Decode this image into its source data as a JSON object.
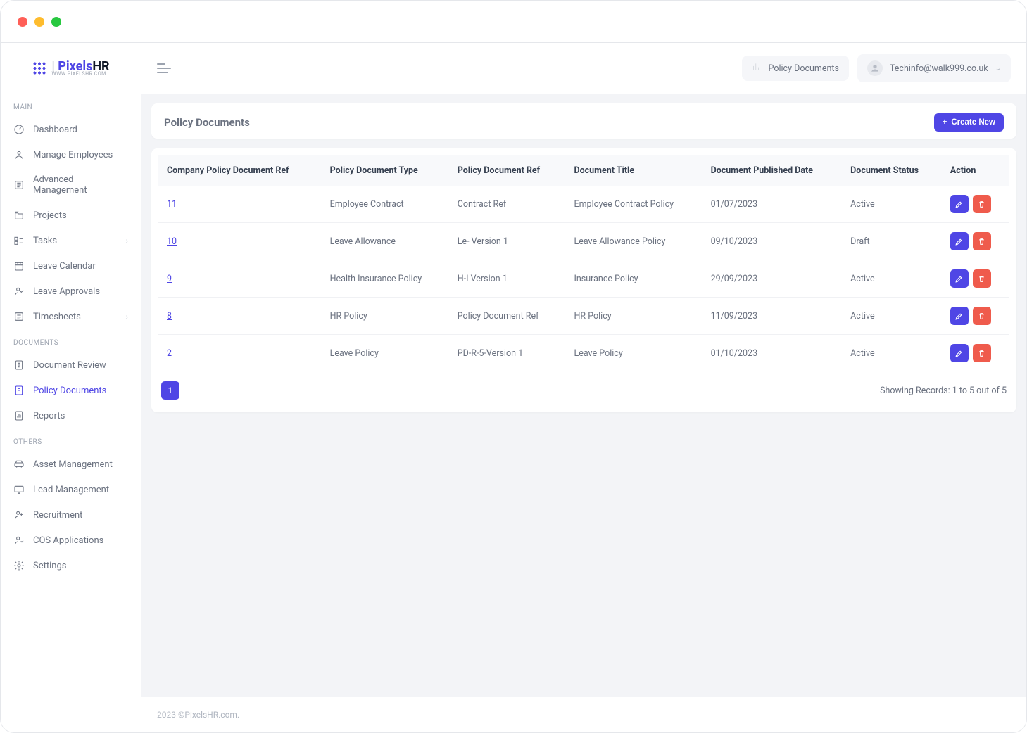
{
  "logo": {
    "brand_a": "Pixels",
    "brand_b": "HR",
    "sub": "WWW.PIXELSHR.COM"
  },
  "sidebar": {
    "sections": [
      {
        "title": "MAIN",
        "items": [
          {
            "label": "Dashboard"
          },
          {
            "label": "Manage Employees"
          },
          {
            "label": "Advanced Management"
          },
          {
            "label": "Projects"
          },
          {
            "label": "Tasks",
            "chevron": true
          },
          {
            "label": "Leave Calendar"
          },
          {
            "label": "Leave Approvals"
          },
          {
            "label": "Timesheets",
            "chevron": true
          }
        ]
      },
      {
        "title": "DOCUMENTS",
        "items": [
          {
            "label": "Document Review"
          },
          {
            "label": "Policy Documents",
            "active": true
          },
          {
            "label": "Reports"
          }
        ]
      },
      {
        "title": "OTHERS",
        "items": [
          {
            "label": "Asset Management"
          },
          {
            "label": "Lead Management"
          },
          {
            "label": "Recruitment"
          },
          {
            "label": "COS Applications"
          },
          {
            "label": "Settings"
          }
        ]
      }
    ]
  },
  "topbar": {
    "breadcrumb": "Policy Documents",
    "user_email": "Techinfo@walk999.co.uk"
  },
  "page": {
    "title": "Policy Documents",
    "create_label": "Create New"
  },
  "table": {
    "headers": {
      "ref": "Company Policy Document Ref",
      "type": "Policy Document Type",
      "doc_ref": "Policy Document Ref",
      "title": "Document Title",
      "published": "Document Published Date",
      "status": "Document Status",
      "action": "Action"
    },
    "rows": [
      {
        "ref": "11",
        "type": "Employee Contract",
        "doc_ref": "Contract Ref",
        "title": "Employee Contract Policy",
        "published": "01/07/2023",
        "status": "Active"
      },
      {
        "ref": "10",
        "type": "Leave Allowance",
        "doc_ref": "Le- Version 1",
        "title": "Leave Allowance Policy",
        "published": "09/10/2023",
        "status": "Draft"
      },
      {
        "ref": "9",
        "type": "Health Insurance Policy",
        "doc_ref": "H-I Version 1",
        "title": "Insurance Policy",
        "published": "29/09/2023",
        "status": "Active"
      },
      {
        "ref": "8",
        "type": "HR Policy",
        "doc_ref": "Policy Document Ref",
        "title": "HR Policy",
        "published": "11/09/2023",
        "status": "Active"
      },
      {
        "ref": "2",
        "type": "Leave Policy",
        "doc_ref": "PD-R-5-Version 1",
        "title": "Leave Policy",
        "published": "01/10/2023",
        "status": "Active"
      }
    ],
    "page_current": "1",
    "records_text": "Showing Records: 1 to 5 out of 5"
  },
  "footer": "2023 ©PixelsHR.com."
}
